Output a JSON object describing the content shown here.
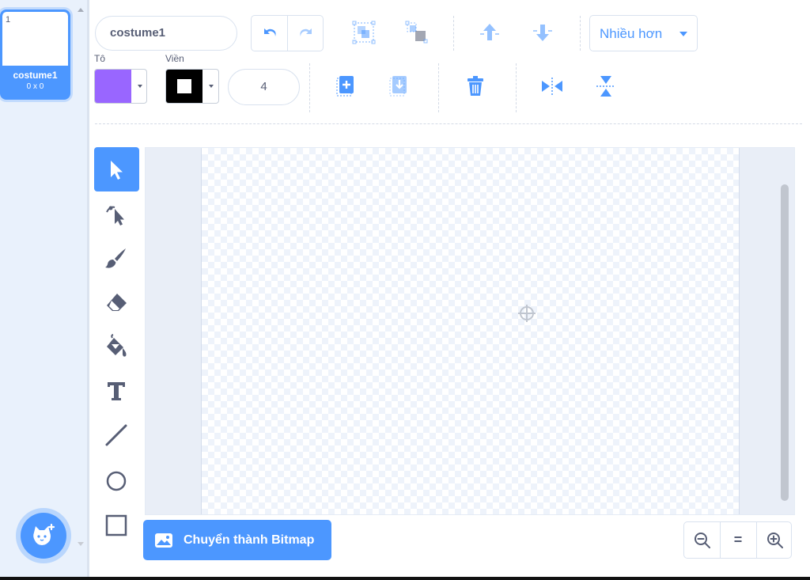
{
  "costume_list": {
    "items": [
      {
        "number": "1",
        "name": "costume1",
        "size": "0 x 0"
      }
    ]
  },
  "toolbar": {
    "costume_name": "costume1",
    "more_label": "Nhiều hơn",
    "fill_label": "Tô",
    "outline_label": "Viền",
    "stroke_width": "4"
  },
  "colors": {
    "accent": "#4c97ff",
    "fill": "#9966ff",
    "outline": "#000000",
    "text": "#575e75"
  },
  "tools": [
    {
      "name": "select",
      "icon": "select-arrow-icon",
      "selected": true
    },
    {
      "name": "reshape",
      "icon": "reshape-icon",
      "selected": false
    },
    {
      "name": "brush",
      "icon": "brush-icon",
      "selected": false
    },
    {
      "name": "eraser",
      "icon": "eraser-icon",
      "selected": false
    },
    {
      "name": "fill",
      "icon": "paint-bucket-icon",
      "selected": false
    },
    {
      "name": "text",
      "icon": "text-icon",
      "selected": false
    },
    {
      "name": "line",
      "icon": "line-icon",
      "selected": false
    },
    {
      "name": "circle",
      "icon": "circle-icon",
      "selected": false
    },
    {
      "name": "rectangle",
      "icon": "rectangle-icon",
      "selected": false
    }
  ],
  "bottom": {
    "convert_label": "Chuyển thành Bitmap",
    "zoom_reset_label": "="
  }
}
